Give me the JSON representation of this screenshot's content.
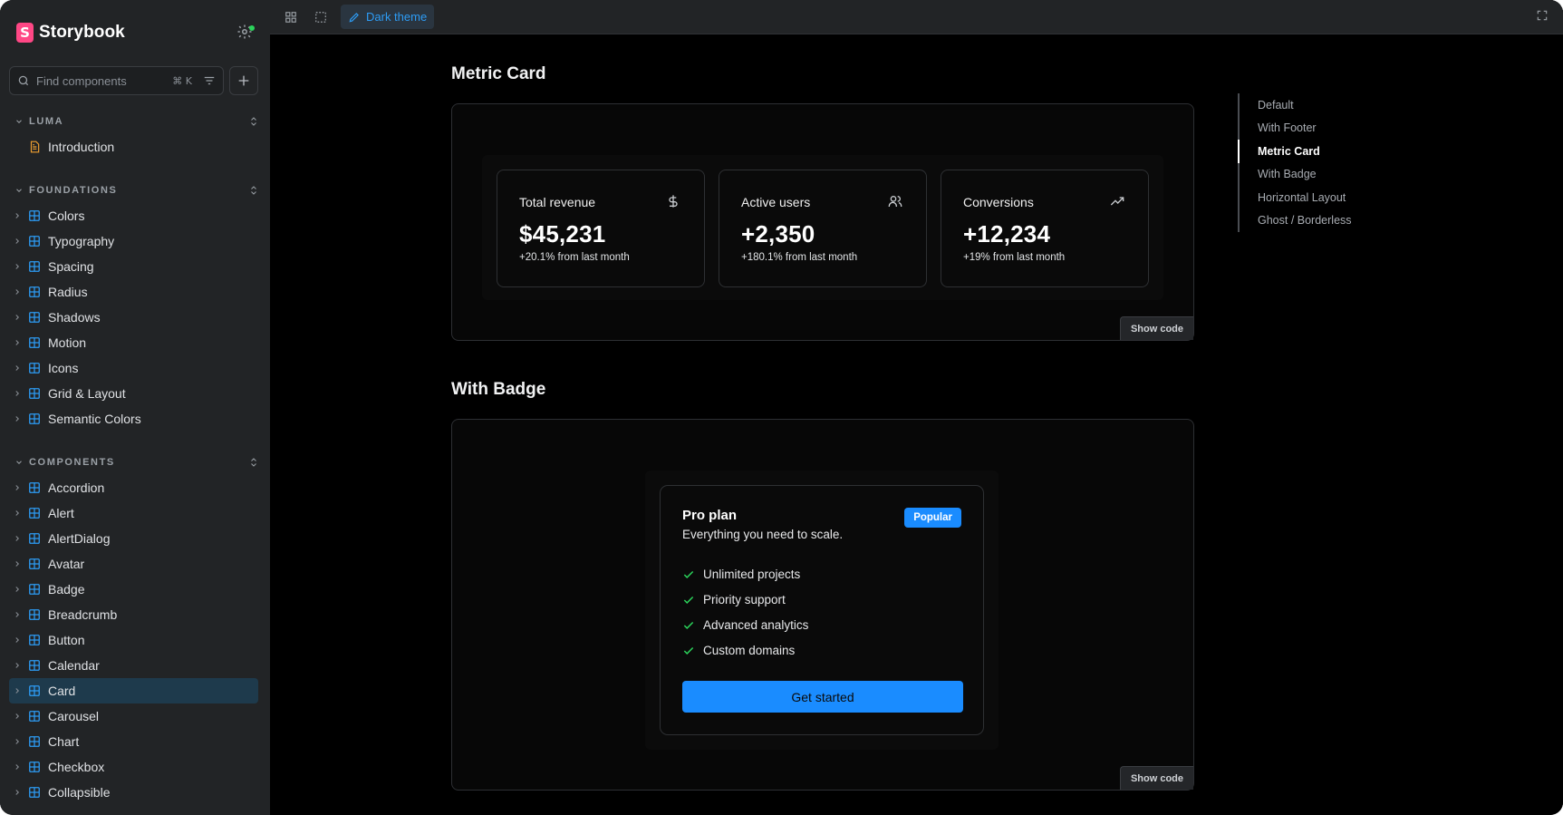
{
  "sidebar": {
    "brand": "Storybook",
    "search_placeholder": "Find components",
    "search_shortcut": "⌘ K",
    "sections": [
      {
        "label": "LUMA",
        "items": [
          "Introduction"
        ]
      },
      {
        "label": "FOUNDATIONS",
        "items": [
          "Colors",
          "Typography",
          "Spacing",
          "Radius",
          "Shadows",
          "Motion",
          "Icons",
          "Grid & Layout",
          "Semantic Colors"
        ]
      },
      {
        "label": "COMPONENTS",
        "items": [
          "Accordion",
          "Alert",
          "AlertDialog",
          "Avatar",
          "Badge",
          "Breadcrumb",
          "Button",
          "Calendar",
          "Card",
          "Carousel",
          "Chart",
          "Checkbox",
          "Collapsible"
        ]
      }
    ],
    "selected_item": "Card"
  },
  "toolbar": {
    "theme_label": "Dark theme"
  },
  "stories": {
    "metric": {
      "title": "Metric Card",
      "show_code": "Show code",
      "cards": [
        {
          "title": "Total revenue",
          "value": "$45,231",
          "sub": "+20.1% from last month",
          "icon": "dollar-icon"
        },
        {
          "title": "Active users",
          "value": "+2,350",
          "sub": "+180.1% from last month",
          "icon": "users-icon"
        },
        {
          "title": "Conversions",
          "value": "+12,234",
          "sub": "+19% from last month",
          "icon": "trending-up-icon"
        }
      ]
    },
    "badge": {
      "title": "With Badge",
      "show_code": "Show code",
      "plan_title": "Pro plan",
      "plan_sub": "Everything you need to scale.",
      "badge": "Popular",
      "features": [
        "Unlimited projects",
        "Priority support",
        "Advanced analytics",
        "Custom domains"
      ],
      "cta": "Get started"
    }
  },
  "toc": {
    "items": [
      "Default",
      "With Footer",
      "Metric Card",
      "With Badge",
      "Horizontal Layout",
      "Ghost / Borderless"
    ],
    "active": "Metric Card"
  },
  "colors": {
    "brand": "#ff4785",
    "accent": "#1a8cff",
    "check": "#2bd45b"
  }
}
